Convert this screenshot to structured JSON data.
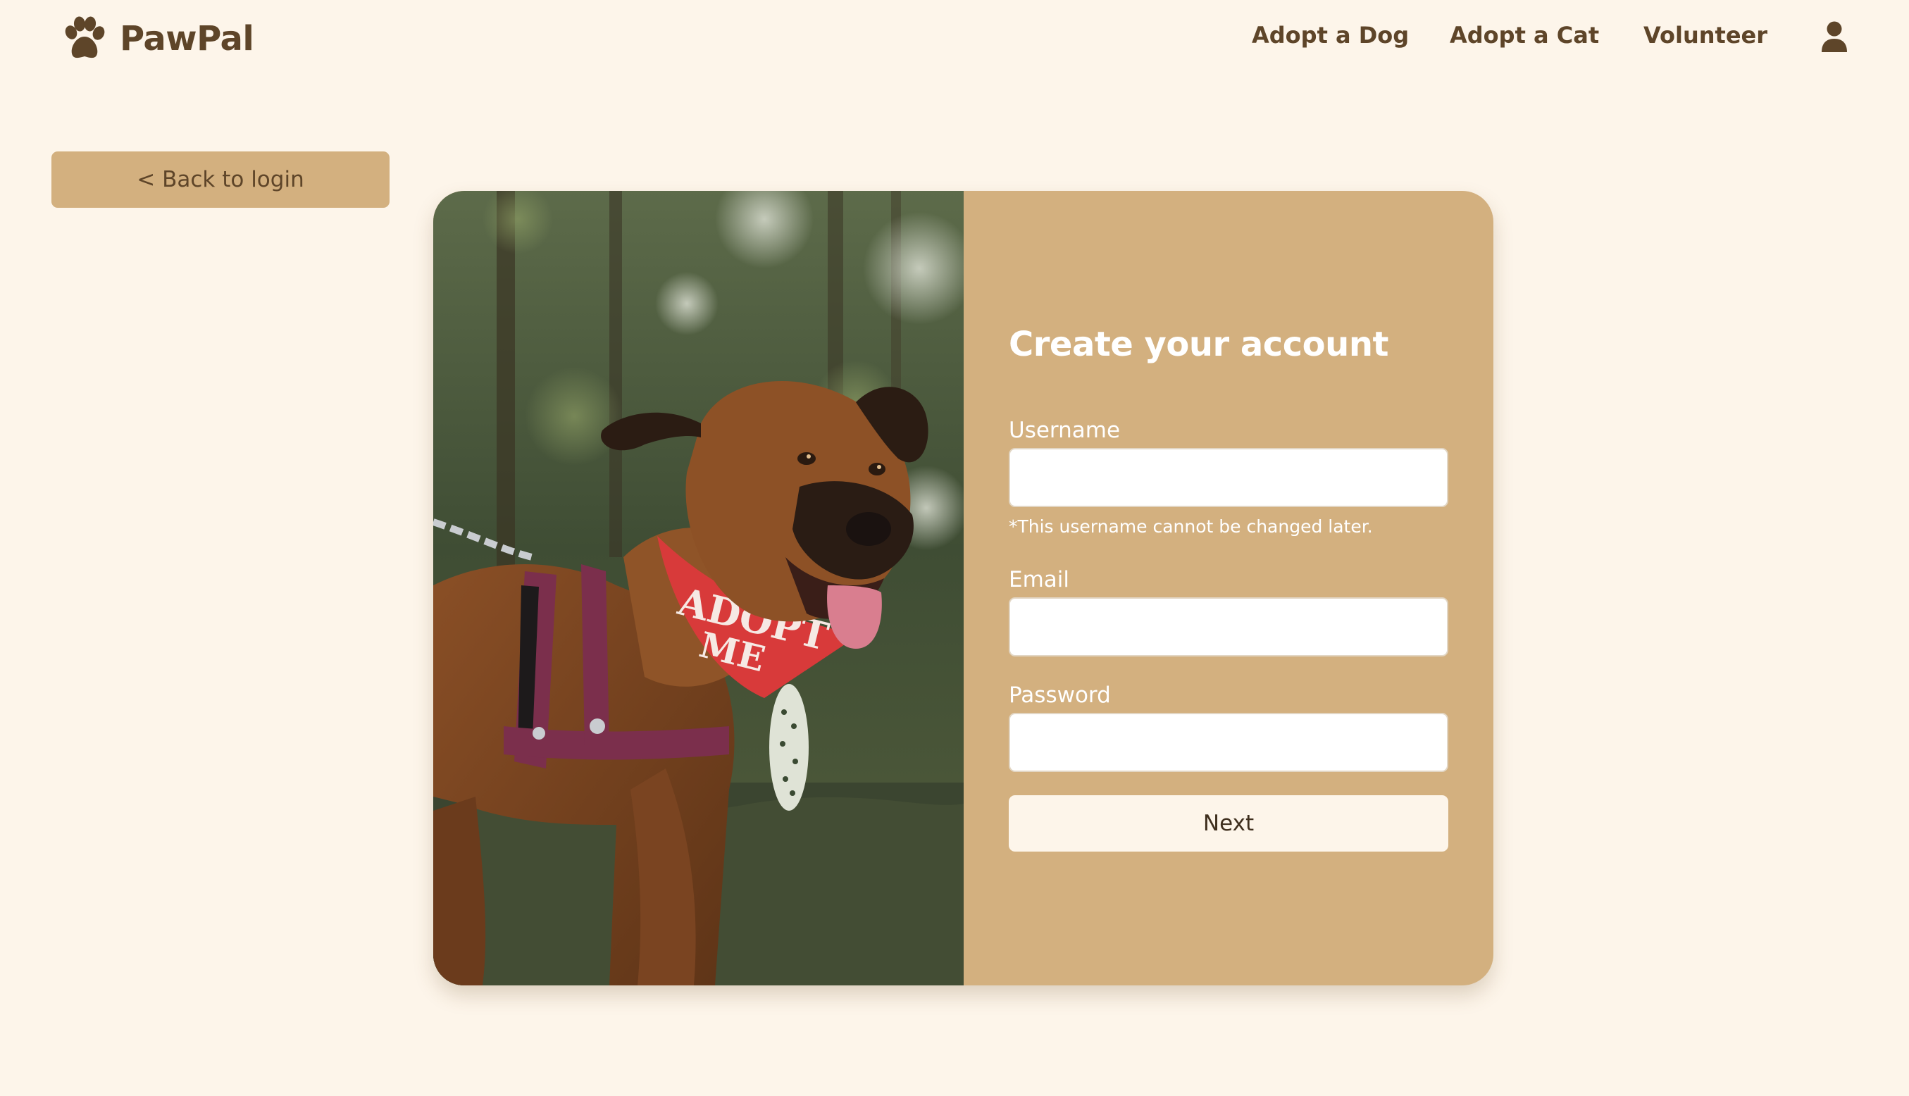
{
  "header": {
    "brand": "PawPal",
    "logo_icon": "paw-icon",
    "nav": [
      {
        "label": "Adopt a Dog"
      },
      {
        "label": "Adopt a Cat"
      },
      {
        "label": "Volunteer"
      }
    ],
    "account_icon": "user-icon"
  },
  "back_button": {
    "label": "< Back to login"
  },
  "signup": {
    "title": "Create your account",
    "username_label": "Username",
    "username_value": "",
    "username_hint": "*This username cannot be changed later.",
    "email_label": "Email",
    "email_value": "",
    "password_label": "Password",
    "password_value": "",
    "submit_label": "Next"
  },
  "photo": {
    "bandana_text_line1": "ADOPT",
    "bandana_text_line2": "ME"
  },
  "colors": {
    "background": "#fdf5ea",
    "accent": "#d3b07f",
    "text_brown": "#5e4529",
    "white": "#ffffff"
  }
}
